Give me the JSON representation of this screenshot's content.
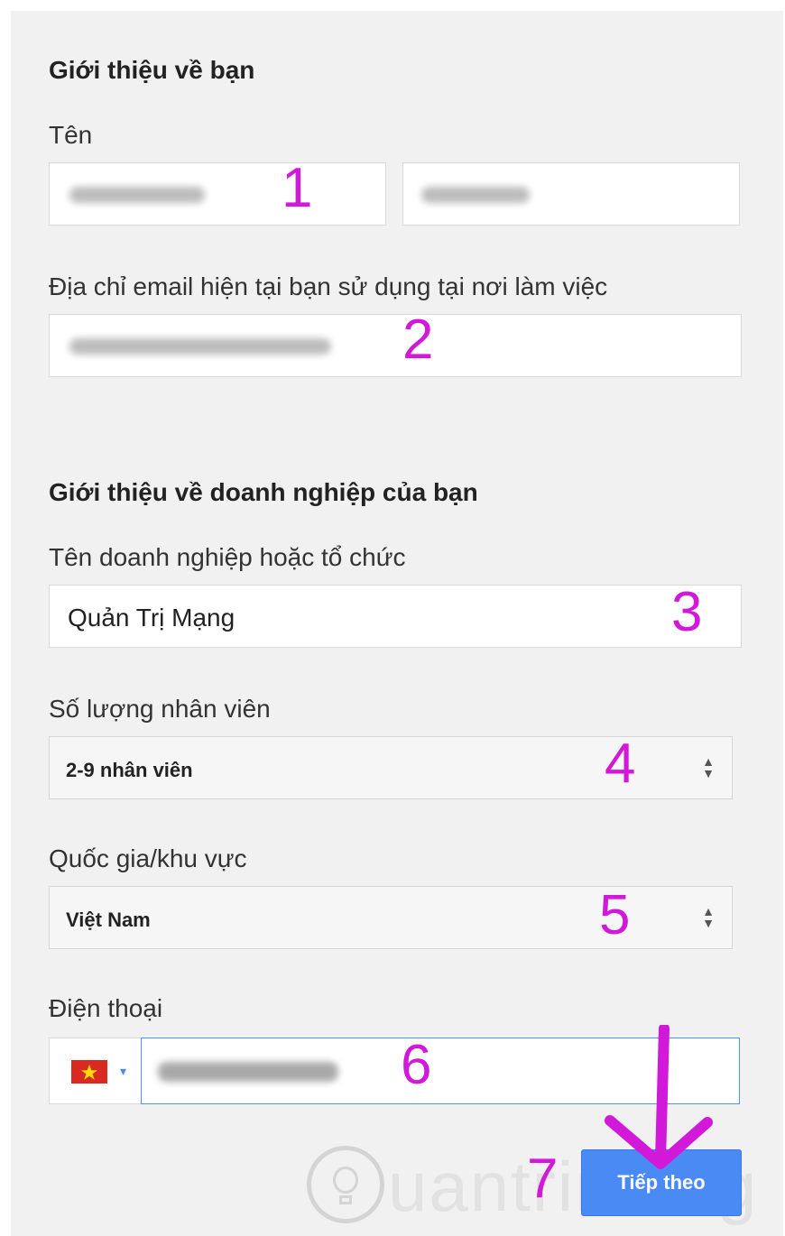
{
  "section_about_you": {
    "title": "Giới thiệu về bạn",
    "name_label": "Tên",
    "email_label": "Địa chỉ email hiện tại bạn sử dụng tại nơi làm việc"
  },
  "section_business": {
    "title": "Giới thiệu về doanh nghiệp của bạn",
    "org_label": "Tên doanh nghiệp hoặc tổ chức",
    "org_value": "Quản Trị Mạng",
    "employees_label": "Số lượng nhân viên",
    "employees_value": "2-9 nhân viên",
    "country_label": "Quốc gia/khu vực",
    "country_value": "Việt Nam",
    "phone_label": "Điện thoại"
  },
  "annotations": {
    "n1": "1",
    "n2": "2",
    "n3": "3",
    "n4": "4",
    "n5": "5",
    "n6": "6",
    "n7": "7"
  },
  "next_button": "Tiếp theo",
  "watermark_text": "uantrimang",
  "colors": {
    "annotation": "#d218d8",
    "button": "#4a8af4",
    "panel": "#f1f1f1"
  }
}
